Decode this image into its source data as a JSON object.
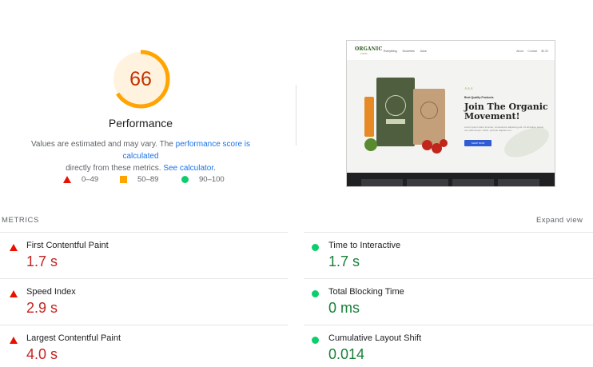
{
  "performance": {
    "score": "66",
    "score_fraction": 0.66,
    "title": "Performance",
    "desc_part1": "Values are estimated and may vary. The ",
    "desc_link1": "performance score is calculated",
    "desc_part2": " directly from these metrics. ",
    "desc_link2": "See calculator",
    "desc_part3": "."
  },
  "legend": [
    {
      "range": "0–49",
      "shape": "triangle",
      "color": "#eb0f00"
    },
    {
      "range": "50–89",
      "shape": "square",
      "color": "#ffa400"
    },
    {
      "range": "90–100",
      "shape": "circle",
      "color": "#0cce6b"
    }
  ],
  "screenshot": {
    "logo": "ORGANIC",
    "logo_sub": "FOOD",
    "nav_links": "Everything Groceries Juice",
    "nav_right": "About Contact $0.00",
    "hero_sub": "Best Quality Products",
    "hero_title": "Join The Organic Movement!",
    "hero_text": "Lorem ipsum dolor sit amet, consectetur adipiscing elit. Ut elit tellus, luctus nec ullamcorper mattis, pulvinar dapibus leo.",
    "hero_button": "SHOP NOW",
    "bag_label": "ORGANIC"
  },
  "metrics": {
    "label": "METRICS",
    "expand": "Expand view",
    "items": [
      {
        "name": "First Contentful Paint",
        "value": "1.7 s",
        "status": "fail"
      },
      {
        "name": "Time to Interactive",
        "value": "1.7 s",
        "status": "pass"
      },
      {
        "name": "Speed Index",
        "value": "2.9 s",
        "status": "fail"
      },
      {
        "name": "Total Blocking Time",
        "value": "0 ms",
        "status": "pass"
      },
      {
        "name": "Largest Contentful Paint",
        "value": "4.0 s",
        "status": "fail"
      },
      {
        "name": "Cumulative Layout Shift",
        "value": "0.014",
        "status": "pass"
      }
    ]
  },
  "colors": {
    "gauge_arc": "#ffa400",
    "gauge_bg": "#fff3e0",
    "score_text": "#c33300",
    "fail": "#c5221f",
    "pass": "#188038",
    "link": "#1a73e8"
  }
}
